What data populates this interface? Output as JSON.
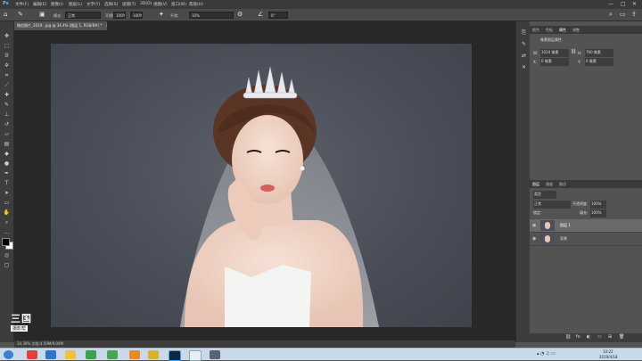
{
  "menubar": {
    "logo": "Ps",
    "items": [
      "文件(F)",
      "编辑(E)",
      "图像(I)",
      "图层(L)",
      "文字(Y)",
      "选择(S)",
      "滤镜(T)",
      "3D(D)",
      "视图(V)",
      "窗口(W)",
      "帮助(H)"
    ],
    "minimize": "—",
    "maximize": "□",
    "close": "✕"
  },
  "optbar": {
    "mode_label": "模式:",
    "mode_value": "正常",
    "opacity_label": "不透明度:",
    "opacity_value": "100%",
    "flow_label": "流量:",
    "flow_value": "100%",
    "smooth_label": "平滑:",
    "smooth_value": "10%",
    "angle_value": "0°"
  },
  "document": {
    "tab_title": "微信图片_2019...jpg @ 34.4% (图层 1, RGB/8#) *",
    "status": "34.39%   文档:4.50M/9.00M"
  },
  "watermark": {
    "line1": "三国",
    "line2": "摄影帮"
  },
  "panel_top": {
    "tabs": [
      "颜色",
      "色板",
      "属性",
      "调整"
    ],
    "title": "像素图层属性",
    "w_label": "W:",
    "w_value": "1024 像素",
    "h_label": "H:",
    "h_value": "700 像素",
    "x_label": "X:",
    "x_value": "0 像素",
    "y_label": "Y:",
    "y_value": "0 像素"
  },
  "layers_panel": {
    "tabs": [
      "图层",
      "通道",
      "路径"
    ],
    "kind_label": "类型",
    "blend_mode": "正常",
    "opacity_label": "不透明度:",
    "opacity_value": "100%",
    "lock_label": "锁定:",
    "fill_label": "填充:",
    "fill_value": "100%",
    "layers": [
      {
        "name": "图层 1"
      },
      {
        "name": "背景"
      }
    ]
  },
  "taskbar": {
    "time": "10:22",
    "date": "2019/4/18"
  },
  "colors": {
    "accent": "#2d8ceb",
    "canvas_bg": "#4b4f59"
  }
}
